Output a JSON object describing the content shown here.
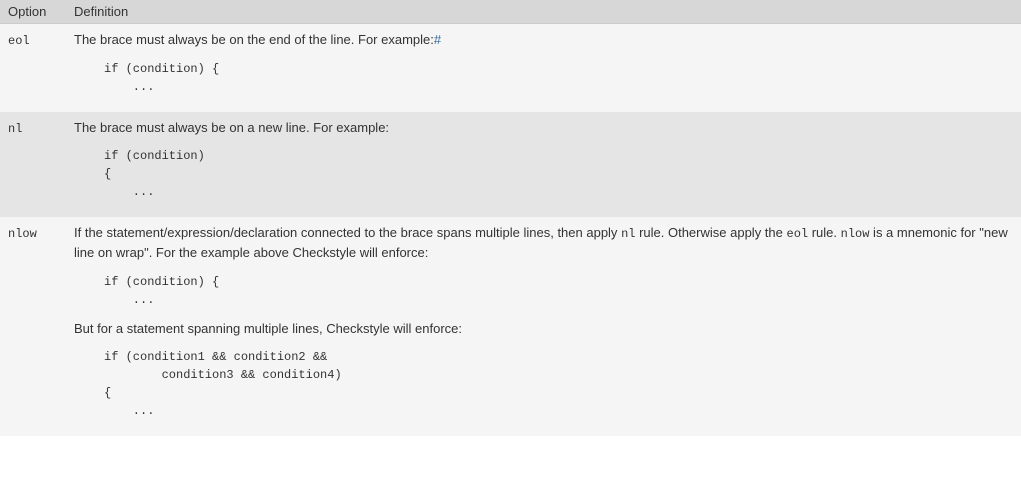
{
  "headers": {
    "option": "Option",
    "definition": "Definition"
  },
  "rows": {
    "eol": {
      "name": "eol",
      "desc": "The brace must always be on the end of the line. For example:",
      "hash": "#",
      "code": "if (condition) {\n    ..."
    },
    "nl": {
      "name": "nl",
      "desc": "The brace must always be on a new line. For example:",
      "code": "if (condition)\n{\n    ..."
    },
    "nlow": {
      "name": "nlow",
      "desc_part1": "If the statement/expression/declaration connected to the brace spans multiple lines, then apply ",
      "nl_ref": "nl",
      "desc_part2": " rule. Otherwise apply the ",
      "eol_ref": "eol",
      "desc_part3": " rule. ",
      "nlow_ref": "nlow",
      "desc_part4": " is a mnemonic for \"new line on wrap\". For the example above Checkstyle will enforce:",
      "code1": "if (condition) {\n    ...",
      "desc_mid": "But for a statement spanning multiple lines, Checkstyle will enforce:",
      "code2": "if (condition1 && condition2 &&\n        condition3 && condition4)\n{\n    ..."
    }
  }
}
